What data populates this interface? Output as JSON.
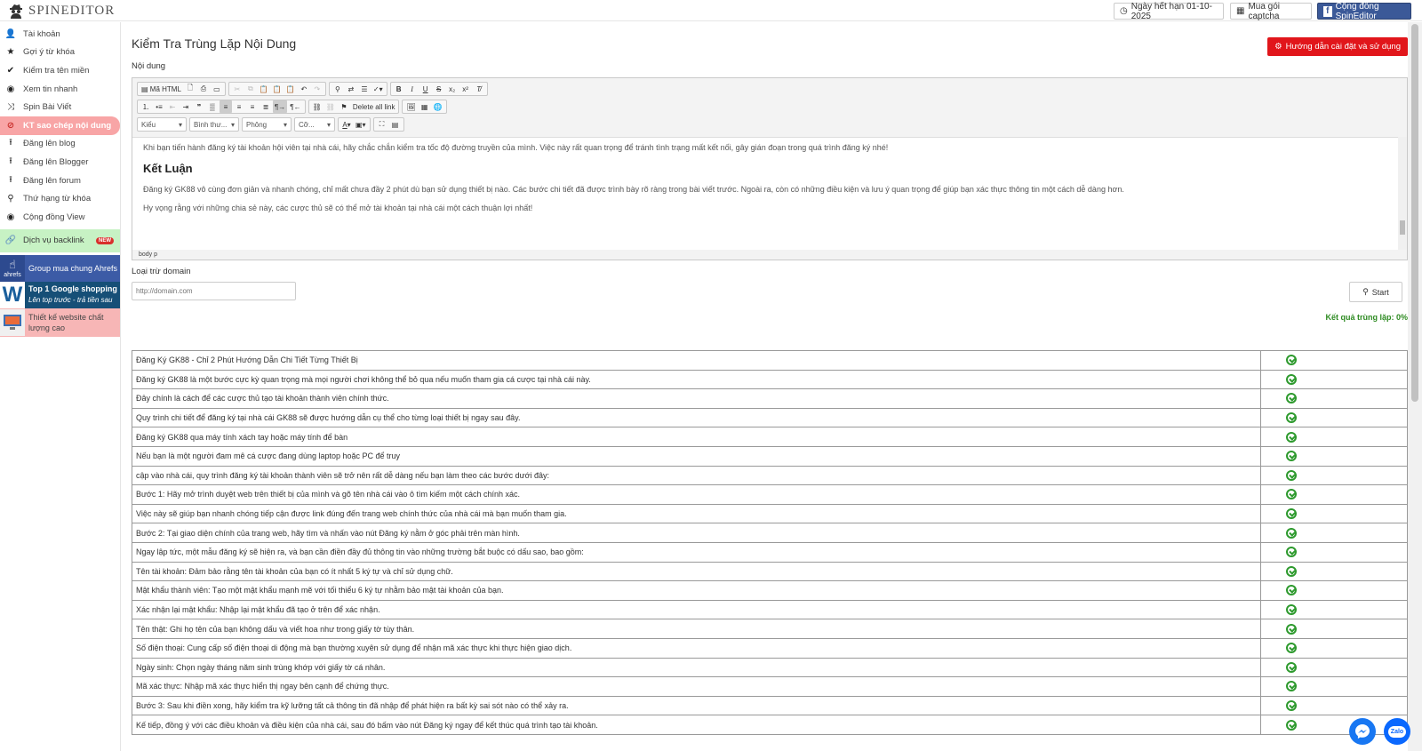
{
  "app": {
    "logo_text": "SPINEDITOR"
  },
  "topbar": {
    "expiry": "Ngày hết hạn 01-10-2025",
    "captcha": "Mua gói captcha",
    "community": "Cộng đồng SpinEditor"
  },
  "sidebar": {
    "items": [
      {
        "label": "Tài khoản",
        "icon": "user-icon"
      },
      {
        "label": "Gợi ý từ khóa",
        "icon": "star-icon"
      },
      {
        "label": "Kiểm tra tên miền",
        "icon": "check-icon"
      },
      {
        "label": "Xem tin nhanh",
        "icon": "eye-icon"
      },
      {
        "label": "Spin Bài Viết",
        "icon": "shuffle-icon"
      },
      {
        "label": "KT sao chép nội dung",
        "icon": "ban-icon"
      },
      {
        "label": "Đăng lên blog",
        "icon": "upload-icon"
      },
      {
        "label": "Đăng lên Blogger",
        "icon": "upload-icon"
      },
      {
        "label": "Đăng lên forum",
        "icon": "upload-icon"
      },
      {
        "label": "Thứ hạng từ khóa",
        "icon": "search-icon"
      },
      {
        "label": "Cộng đồng View",
        "icon": "eye-icon"
      }
    ],
    "backlink": {
      "label": "Dịch vụ backlink",
      "badge": "NEW"
    },
    "promos": {
      "ahrefs": {
        "label": "Group mua chung Ahrefs",
        "thumb": "ahrefs"
      },
      "google": {
        "title": "Top 1 Google shopping",
        "subtitle": "Lên top trước - trả tiền sau"
      },
      "website": {
        "label": "Thiết kế website chất lượng cao"
      }
    }
  },
  "main": {
    "title": "Kiểm Tra Trùng Lặp Nội Dung",
    "guide_button": "Hướng dẫn cài đặt và sử dụng",
    "content_label": "Nội dung",
    "exclude_label": "Loại trừ domain",
    "domain_placeholder": "http://domain.com",
    "start_button": "Start",
    "result": "Kết quả trùng lặp: 0%"
  },
  "editor": {
    "source_label": "Mã HTML",
    "delete_links": "Delete all link",
    "combos": [
      "Kiểu",
      "Bình thư...",
      "Phông",
      "Cỡ..."
    ],
    "path": "body   p",
    "paragraphs": {
      "p1": "Khi bạn tiến hành đăng ký tài khoản hội viên tại nhà cái, hãy chắc chắn kiểm tra tốc độ đường truyền của mình. Việc này rất quan trọng để tránh tình trạng mất kết nối, gây gián đoạn trong quá trình đăng ký nhé!",
      "heading": "Kết Luận",
      "p2": "Đăng ký GK88 vô cùng đơn giản và nhanh chóng, chỉ mất chưa đầy 2 phút dù bạn sử dụng thiết bị nào. Các bước chi tiết đã được trình bày rõ ràng trong bài viết trước. Ngoài ra, còn có những điều kiện và lưu ý quan trọng để giúp bạn xác thực thông tin một cách dễ dàng hơn.",
      "p3": "Hy vọng rằng với những chia sẻ này, các cược thủ sẽ có thể mở tài khoản tại nhà cái một cách thuận lợi nhất!"
    }
  },
  "results": [
    "Đăng Ký GK88 - Chỉ 2 Phút Hướng Dẫn Chi Tiết Từng Thiết Bị",
    "Đăng ký GK88 là một bước cực kỳ quan trọng mà mọi người chơi không thể bỏ qua nếu muốn tham gia cá cược tại nhà cái này.",
    "Đây chính là cách để các cược thủ tạo tài khoản thành viên chính thức.",
    "Quy trình chi tiết để đăng ký tại nhà cái GK88 sẽ được hướng dẫn cụ thể cho từng loại thiết bị ngay sau đây.",
    "Đăng ký GK88 qua máy tính xách tay hoặc máy tính để bàn",
    "Nếu bạn là một người đam mê cá cược đang dùng laptop hoặc PC để truy",
    "cập vào nhà cái, quy trình đăng ký tài khoản thành viên sẽ trở nên rất dễ dàng nếu bạn làm theo các bước dưới đây:",
    "Bước 1: Hãy mở trình duyệt web trên thiết bị của mình và gõ tên nhà cái vào ô tìm kiếm một cách chính xác.",
    "Việc này sẽ giúp bạn nhanh chóng tiếp cận được link đúng đến trang web chính thức của nhà cái mà bạn muốn tham gia.",
    "Bước 2: Tại giao diện chính của trang web, hãy tìm và nhấn vào nút Đăng ký nằm ở góc phải trên màn hình.",
    "Ngay lập tức, một mẫu đăng ký sẽ hiện ra, và bạn cần điền đầy đủ thông tin vào những trường bắt buộc có dấu sao, bao gồm:",
    "Tên tài khoản: Đảm bảo rằng tên tài khoản của bạn có ít nhất 5 ký tự và chỉ sử dụng chữ.",
    "Mật khẩu thành viên: Tạo một mật khẩu mạnh mẽ với tối thiểu 6 ký tự nhằm bảo mật tài khoản của bạn.",
    "Xác nhận lại mật khẩu: Nhập lại mật khẩu đã tạo ở trên để xác nhận.",
    "Tên thật: Ghi họ tên của bạn không dấu và viết hoa như trong giấy tờ tùy thân.",
    "Số điện thoại: Cung cấp số điện thoại di động mà bạn thường xuyên sử dụng để nhận mã xác thực khi thực hiện giao dịch.",
    "Ngày sinh: Chọn ngày tháng năm sinh trùng khớp với giấy tờ cá nhân.",
    "Mã xác thực: Nhập mã xác thực hiển thị ngay bên cạnh để chứng thực.",
    "Bước 3: Sau khi điền xong, hãy kiểm tra kỹ lưỡng tất cả thông tin đã nhập để phát hiện ra bất kỳ sai sót nào có thể xảy ra.",
    "Kế tiếp, đồng ý với các điều khoản và điều kiện của nhà cái, sau đó bấm vào nút Đăng ký ngay để kết thúc quá trình tạo tài khoản."
  ],
  "floating": {
    "messenger": "messenger-icon",
    "zalo": "Zalo"
  }
}
